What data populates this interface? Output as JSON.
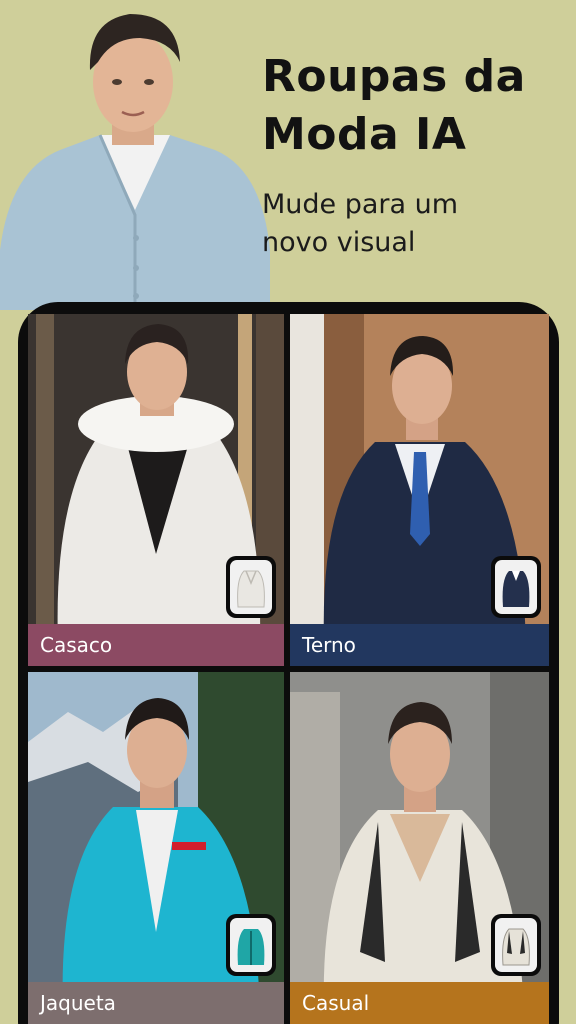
{
  "hero": {
    "title": "Roupas da Moda IA",
    "subtitle": "Mude para um novo visual"
  },
  "styles": [
    {
      "label": "Casaco",
      "bar_color": "#8c4a63",
      "garment_icon": "fur-coat-icon"
    },
    {
      "label": "Terno",
      "bar_color": "#22375f",
      "garment_icon": "suit-icon"
    },
    {
      "label": "Jaqueta",
      "bar_color": "#7d6e6e",
      "garment_icon": "ski-jacket-icon"
    },
    {
      "label": "Casual",
      "bar_color": "#b5741d",
      "garment_icon": "vest-shirt-icon"
    }
  ],
  "colors": {
    "background": "#cfcf9a",
    "frame": "#0c0c0c"
  }
}
